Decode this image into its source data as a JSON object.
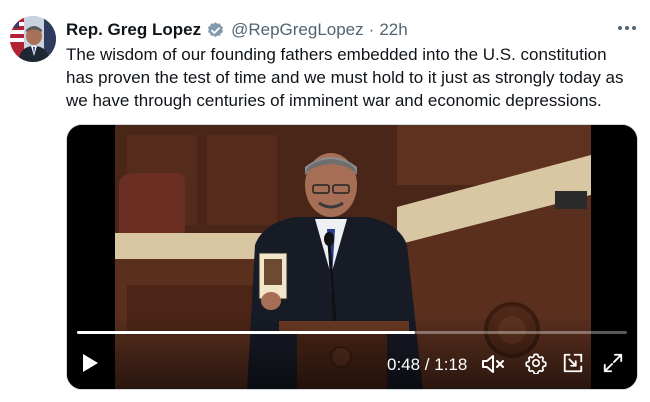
{
  "tweet": {
    "author_name": "Rep. Greg Lopez",
    "verified_icon": "verified-badge-icon",
    "handle": "@RepGregLopez",
    "separator": "·",
    "time": "22h",
    "more_icon": "more-options-icon",
    "text": "The wisdom of our founding fathers embedded into the U.S. constitution has proven the test of time and we must hold to it just as strongly today as we have through centuries of imminent war and economic depressions."
  },
  "video": {
    "current_time": "0:48",
    "duration": "1:18",
    "timecode": "0:48 / 1:18",
    "progress_fraction": 0.615,
    "play_icon": "play-icon",
    "mute_icon": "muted-speaker-icon",
    "settings_icon": "gear-icon",
    "pip_icon": "picture-in-picture-icon",
    "fullscreen_icon": "expand-icon"
  },
  "colors": {
    "verified": "#829aab",
    "secondary_text": "#536471",
    "wood": "#5a2f1e"
  }
}
